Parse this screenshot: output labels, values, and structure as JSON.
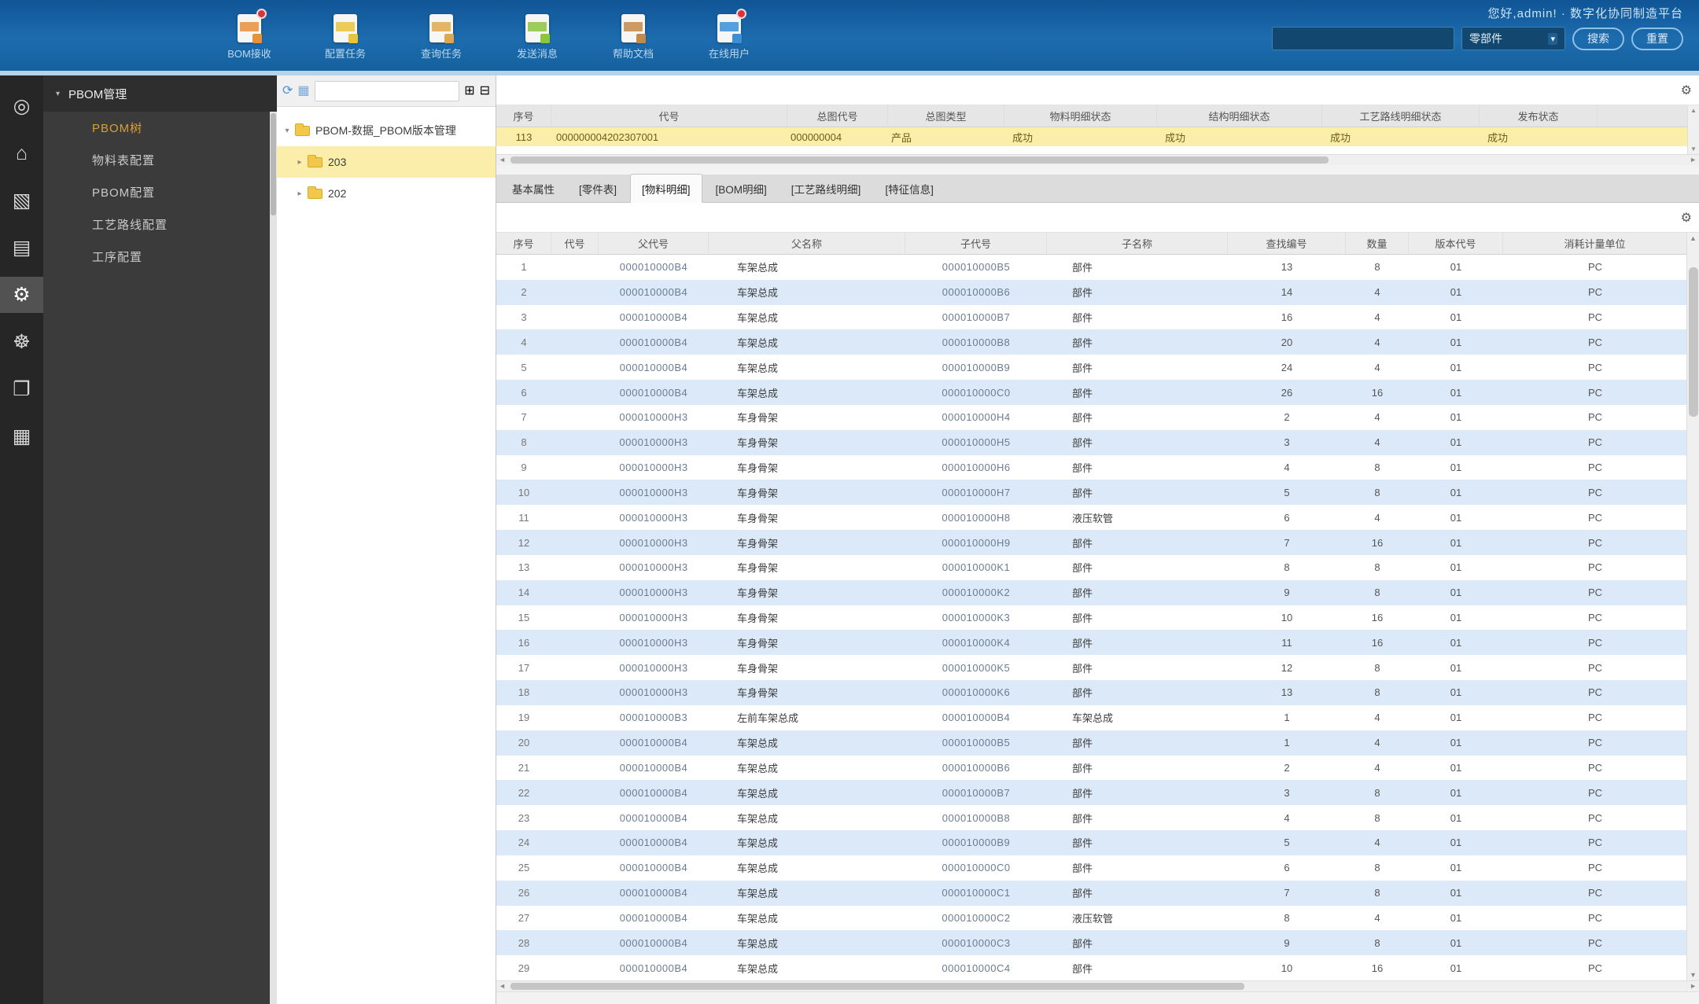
{
  "titlebar": {
    "user_text": "您好,admin! · 数字化协同制造平台"
  },
  "toolbar": {
    "items": [
      {
        "name": "bom-receive-button",
        "label": "BOM接收",
        "icon": "doc-pin-red-icon",
        "accent": "#e8903a",
        "badge": "#d6363e"
      },
      {
        "name": "config-task-button",
        "label": "配置任务",
        "icon": "doc-pencil-yellow-icon",
        "accent": "#e8c43a",
        "badge": ""
      },
      {
        "name": "query-task-button",
        "label": "查询任务",
        "icon": "doc-clip-orange-icon",
        "accent": "#e0a84e",
        "badge": ""
      },
      {
        "name": "send-message-button",
        "label": "发送消息",
        "icon": "mail-green-icon",
        "accent": "#8cc63e",
        "badge": ""
      },
      {
        "name": "help-doc-button",
        "label": "帮助文档",
        "icon": "doc-brown-icon",
        "accent": "#c58a4a",
        "badge": ""
      },
      {
        "name": "online-users-button",
        "label": "在线用户",
        "icon": "users-pin-red-icon",
        "accent": "#3a8fd8",
        "badge": "#d6363e"
      }
    ],
    "search_placeholder": "",
    "dropdown_label": "零部件",
    "dropdown_arrow": "▾",
    "search_button": "搜索",
    "reset_button": "重置"
  },
  "rail": {
    "items": [
      {
        "name": "nav-search-globe",
        "icon": "globe-icon",
        "glyph": "◎",
        "active": false
      },
      {
        "name": "nav-home",
        "icon": "home-icon",
        "glyph": "⌂",
        "active": false
      },
      {
        "name": "nav-reports",
        "icon": "report-icon",
        "glyph": "▧",
        "active": false
      },
      {
        "name": "nav-data",
        "icon": "database-icon",
        "glyph": "▤",
        "active": false
      },
      {
        "name": "nav-process",
        "icon": "gear-icon",
        "glyph": "⚙",
        "active": true
      },
      {
        "name": "nav-settings",
        "icon": "cog-icon",
        "glyph": "☸",
        "active": false
      },
      {
        "name": "nav-library",
        "icon": "book-icon",
        "glyph": "❐",
        "active": false
      },
      {
        "name": "nav-account",
        "icon": "idcard-icon",
        "glyph": "▦",
        "active": false
      }
    ]
  },
  "sidebar": {
    "group": "PBOM管理",
    "caret": "▾",
    "items": [
      {
        "label": "PBOM树",
        "active": true
      },
      {
        "label": "物料表配置",
        "active": false
      },
      {
        "label": "PBOM配置",
        "active": false
      },
      {
        "label": "工艺路线配置",
        "active": false
      },
      {
        "label": "工序配置",
        "active": false
      }
    ]
  },
  "tree": {
    "refresh_glyph": "⟳",
    "filter_glyph": "▦",
    "expand_glyph": "⊞",
    "collapse_glyph": "⊟",
    "root": {
      "label": "PBOM-数据_PBOM版本管理",
      "caret": "▾"
    },
    "children": [
      {
        "label": "203",
        "caret": "▸",
        "selected": true
      },
      {
        "label": "202",
        "caret": "▸",
        "selected": false
      }
    ]
  },
  "master_grid": {
    "columns": [
      "序号",
      "代号",
      "总图代号",
      "总图类型",
      "物料明细状态",
      "结构明细状态",
      "工艺路线明细状态",
      "发布状态",
      ""
    ],
    "rows": [
      [
        "113",
        "000000004202307001",
        "000000004",
        "产品",
        "成功",
        "成功",
        "成功",
        "成功",
        ""
      ]
    ]
  },
  "tabs": [
    {
      "label": "基本属性",
      "active": false
    },
    {
      "label": "[零件表]",
      "active": false
    },
    {
      "label": "[物料明细]",
      "active": true
    },
    {
      "label": "[BOM明细]",
      "active": false
    },
    {
      "label": "[工艺路线明细]",
      "active": false
    },
    {
      "label": "[特征信息]",
      "active": false
    }
  ],
  "detail_grid": {
    "columns": [
      "序号",
      "代号",
      "父代号",
      "父名称",
      "子代号",
      "子名称",
      "查找编号",
      "数量",
      "版本代号",
      "消耗计量单位"
    ],
    "rows": [
      [
        "1",
        "",
        "000010000B4",
        "车架总成",
        "000010000B5",
        "部件",
        "13",
        "8",
        "01",
        "PC"
      ],
      [
        "2",
        "",
        "000010000B4",
        "车架总成",
        "000010000B6",
        "部件",
        "14",
        "4",
        "01",
        "PC"
      ],
      [
        "3",
        "",
        "000010000B4",
        "车架总成",
        "000010000B7",
        "部件",
        "16",
        "4",
        "01",
        "PC"
      ],
      [
        "4",
        "",
        "000010000B4",
        "车架总成",
        "000010000B8",
        "部件",
        "20",
        "4",
        "01",
        "PC"
      ],
      [
        "5",
        "",
        "000010000B4",
        "车架总成",
        "000010000B9",
        "部件",
        "24",
        "4",
        "01",
        "PC"
      ],
      [
        "6",
        "",
        "000010000B4",
        "车架总成",
        "000010000C0",
        "部件",
        "26",
        "16",
        "01",
        "PC"
      ],
      [
        "7",
        "",
        "000010000H3",
        "车身骨架",
        "000010000H4",
        "部件",
        "2",
        "4",
        "01",
        "PC"
      ],
      [
        "8",
        "",
        "000010000H3",
        "车身骨架",
        "000010000H5",
        "部件",
        "3",
        "4",
        "01",
        "PC"
      ],
      [
        "9",
        "",
        "000010000H3",
        "车身骨架",
        "000010000H6",
        "部件",
        "4",
        "8",
        "01",
        "PC"
      ],
      [
        "10",
        "",
        "000010000H3",
        "车身骨架",
        "000010000H7",
        "部件",
        "5",
        "8",
        "01",
        "PC"
      ],
      [
        "11",
        "",
        "000010000H3",
        "车身骨架",
        "000010000H8",
        "液压软管",
        "6",
        "4",
        "01",
        "PC"
      ],
      [
        "12",
        "",
        "000010000H3",
        "车身骨架",
        "000010000H9",
        "部件",
        "7",
        "16",
        "01",
        "PC"
      ],
      [
        "13",
        "",
        "000010000H3",
        "车身骨架",
        "000010000K1",
        "部件",
        "8",
        "8",
        "01",
        "PC"
      ],
      [
        "14",
        "",
        "000010000H3",
        "车身骨架",
        "000010000K2",
        "部件",
        "9",
        "8",
        "01",
        "PC"
      ],
      [
        "15",
        "",
        "000010000H3",
        "车身骨架",
        "000010000K3",
        "部件",
        "10",
        "16",
        "01",
        "PC"
      ],
      [
        "16",
        "",
        "000010000H3",
        "车身骨架",
        "000010000K4",
        "部件",
        "11",
        "16",
        "01",
        "PC"
      ],
      [
        "17",
        "",
        "000010000H3",
        "车身骨架",
        "000010000K5",
        "部件",
        "12",
        "8",
        "01",
        "PC"
      ],
      [
        "18",
        "",
        "000010000H3",
        "车身骨架",
        "000010000K6",
        "部件",
        "13",
        "8",
        "01",
        "PC"
      ],
      [
        "19",
        "",
        "000010000B3",
        "左前车架总成",
        "000010000B4",
        "车架总成",
        "1",
        "4",
        "01",
        "PC"
      ],
      [
        "20",
        "",
        "000010000B4",
        "车架总成",
        "000010000B5",
        "部件",
        "1",
        "4",
        "01",
        "PC"
      ],
      [
        "21",
        "",
        "000010000B4",
        "车架总成",
        "000010000B6",
        "部件",
        "2",
        "4",
        "01",
        "PC"
      ],
      [
        "22",
        "",
        "000010000B4",
        "车架总成",
        "000010000B7",
        "部件",
        "3",
        "8",
        "01",
        "PC"
      ],
      [
        "23",
        "",
        "000010000B4",
        "车架总成",
        "000010000B8",
        "部件",
        "4",
        "8",
        "01",
        "PC"
      ],
      [
        "24",
        "",
        "000010000B4",
        "车架总成",
        "000010000B9",
        "部件",
        "5",
        "4",
        "01",
        "PC"
      ],
      [
        "25",
        "",
        "000010000B4",
        "车架总成",
        "000010000C0",
        "部件",
        "6",
        "8",
        "01",
        "PC"
      ],
      [
        "26",
        "",
        "000010000B4",
        "车架总成",
        "000010000C1",
        "部件",
        "7",
        "8",
        "01",
        "PC"
      ],
      [
        "27",
        "",
        "000010000B4",
        "车架总成",
        "000010000C2",
        "液压软管",
        "8",
        "4",
        "01",
        "PC"
      ],
      [
        "28",
        "",
        "000010000B4",
        "车架总成",
        "000010000C3",
        "部件",
        "9",
        "8",
        "01",
        "PC"
      ],
      [
        "29",
        "",
        "000010000B4",
        "车架总成",
        "000010000C4",
        "部件",
        "10",
        "16",
        "01",
        "PC"
      ]
    ]
  },
  "colors": {
    "topbar_blue": "#1a67ac",
    "sidebar_active_orange": "#dd9f33",
    "selection_yellow": "#fbedaa",
    "row_stripe_blue": "#dbe9f8",
    "tree_expand_cyan": "#2fa3d9",
    "tree_collapse_orange": "#e8833a"
  }
}
